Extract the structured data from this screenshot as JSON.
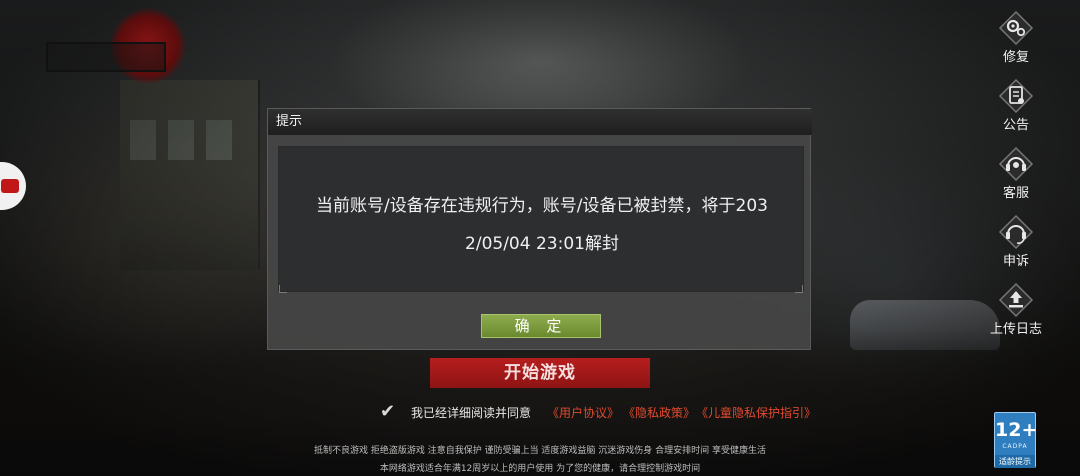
{
  "dialog": {
    "title": "提示",
    "message_line1": "当前账号/设备存在违规行为，账号/设备已被封禁，将于203",
    "message_line2": "2/05/04 23:01解封",
    "confirm_label": "确 定"
  },
  "right_menu": {
    "repair_label": "修复",
    "notice_label": "公告",
    "service_label": "客服",
    "appeal_label": "申诉",
    "upload_log_label": "上传日志"
  },
  "start_button_label": "开始游戏",
  "agreement": {
    "checked": true,
    "text": "我已经详细阅读并同意",
    "user_agreement": "《用户协议》",
    "privacy_policy": "《隐私政策》",
    "child_privacy": "《儿童隐私保护指引》"
  },
  "age_rating": {
    "age": "12+",
    "org": "CADPA",
    "tip": "适龄提示"
  },
  "footer": {
    "line1": "抵制不良游戏 拒绝盗版游戏 注意自我保护 谨防受骗上当 适度游戏益脑 沉迷游戏伤身 合理安排时间 享受健康生活",
    "line2": "本网络游戏适合年满12周岁以上的用户使用    为了您的健康，请合理控制游戏时间"
  },
  "colors": {
    "confirm_green": "#7a9a3c",
    "start_red": "#a01a1a",
    "link_red": "#e04a2e",
    "age_blue": "#2f7fc0"
  },
  "icons": [
    "gear-icon",
    "notice-icon",
    "headset-icon",
    "appeal-headset-icon",
    "upload-icon",
    "biohazard-logo",
    "checkmark-icon"
  ]
}
